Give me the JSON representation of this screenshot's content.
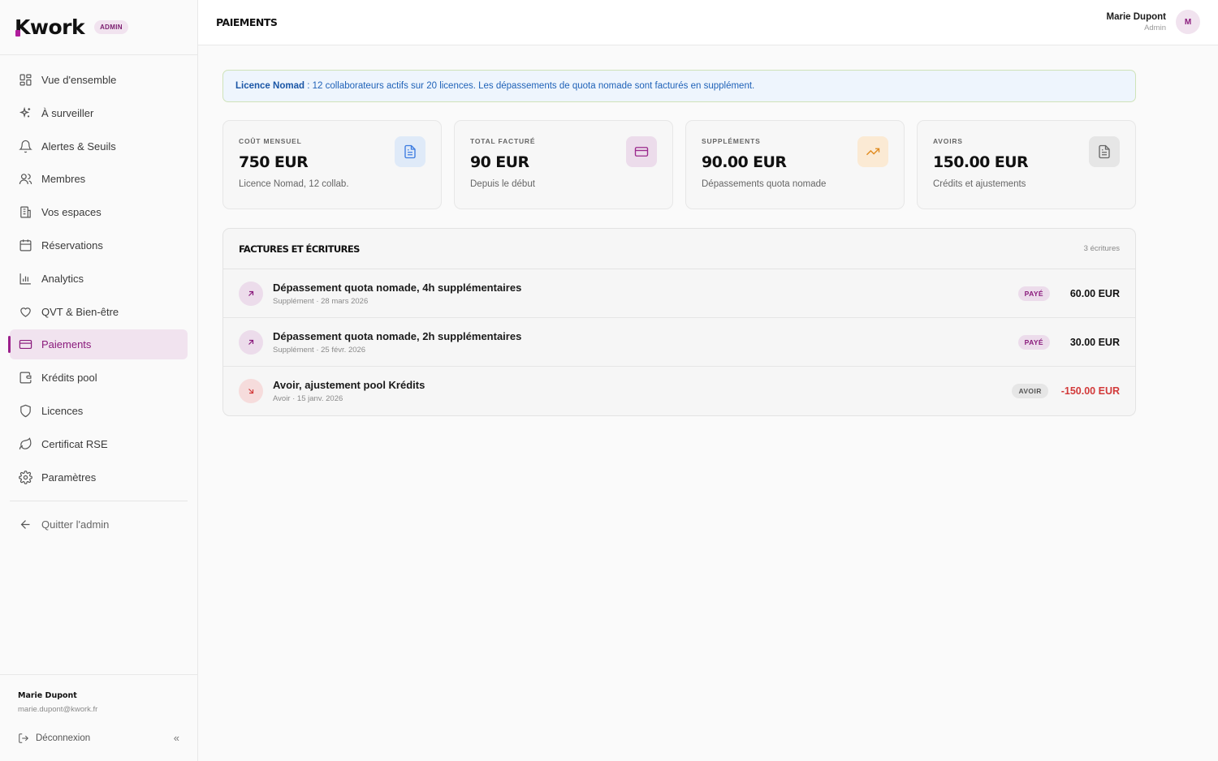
{
  "app": {
    "logo_text": "Kwork",
    "badge": "ADMIN"
  },
  "sidebar": {
    "items": [
      {
        "label": "Vue d'ensemble",
        "icon": "grid-icon"
      },
      {
        "label": "À surveiller",
        "icon": "sparkle-icon"
      },
      {
        "label": "Alertes & Seuils",
        "icon": "bell-icon"
      },
      {
        "label": "Membres",
        "icon": "users-icon"
      },
      {
        "label": "Vos espaces",
        "icon": "building-icon"
      },
      {
        "label": "Réservations",
        "icon": "calendar-icon"
      },
      {
        "label": "Analytics",
        "icon": "bar-chart-icon"
      },
      {
        "label": "QVT & Bien-être",
        "icon": "heart-icon"
      },
      {
        "label": "Paiements",
        "icon": "credit-card-icon",
        "active": true
      },
      {
        "label": "Krédits pool",
        "icon": "wallet-icon"
      },
      {
        "label": "Licences",
        "icon": "shield-icon"
      },
      {
        "label": "Certificat RSE",
        "icon": "leaf-icon"
      },
      {
        "label": "Paramètres",
        "icon": "gear-icon"
      }
    ],
    "quit_label": "Quitter l'admin",
    "footer": {
      "name": "Marie Dupont",
      "email": "marie.dupont@kwork.fr",
      "logout_label": "Déconnexion",
      "collapse_glyph": "«"
    }
  },
  "header": {
    "title": "PAIEMENTS",
    "user_name": "Marie Dupont",
    "user_role": "Admin",
    "avatar_initial": "M"
  },
  "notice": {
    "bold": "Licence Nomad",
    "text": " : 12 collaborateurs actifs sur 20 licences. Les dépassements de quota nomade sont facturés en supplément."
  },
  "cards": [
    {
      "label": "COÛT MENSUEL",
      "value": "750 EUR",
      "sub": "Licence Nomad, 12 collab.",
      "icon": "document-icon",
      "color": "#3b7be0"
    },
    {
      "label": "TOTAL FACTURÉ",
      "value": "90 EUR",
      "sub": "Depuis le début",
      "icon": "credit-card-icon",
      "color": "#9b2a8d"
    },
    {
      "label": "SUPPLÉMENTS",
      "value": "90.00 EUR",
      "sub": "Dépassements quota nomade",
      "icon": "trending-up-icon",
      "color": "#e08a1e"
    },
    {
      "label": "AVOIRS",
      "value": "150.00 EUR",
      "sub": "Crédits et ajustements",
      "icon": "document-icon",
      "color": "#666666"
    }
  ],
  "invoices": {
    "title": "FACTURES ET ÉCRITURES",
    "count": "3 écritures",
    "rows": [
      {
        "title": "Dépassement quota nomade, 4h supplémentaires",
        "meta": "Supplément · 28 mars 2026",
        "badge": "PAYÉ",
        "amount": "60.00 EUR",
        "icon": "arrow-up-right-icon"
      },
      {
        "title": "Dépassement quota nomade, 2h supplémentaires",
        "meta": "Supplément · 25 févr. 2026",
        "badge": "PAYÉ",
        "amount": "30.00 EUR",
        "icon": "arrow-up-right-icon"
      },
      {
        "title": "Avoir, ajustement pool Krédits",
        "meta": "Avoir · 15 janv. 2026",
        "badge": "AVOIR",
        "amount": "-150.00 EUR",
        "icon": "arrow-down-right-icon"
      }
    ]
  }
}
